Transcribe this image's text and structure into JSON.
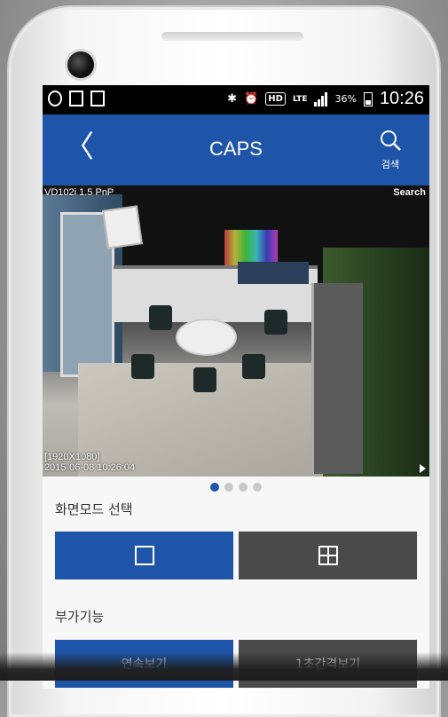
{
  "status_bar": {
    "left_icons": [
      "ring-icon",
      "image-icon",
      "chart-icon"
    ],
    "bluetooth": "✱",
    "alarm": "⏰",
    "hd_badge": "HD",
    "lte_label": "LTE",
    "battery_percent": "36%",
    "time": "10:26"
  },
  "app_bar": {
    "back_glyph": "〈",
    "title": "CAPS",
    "search_label": "검색",
    "accent_color": "#1f55a8"
  },
  "camera_view": {
    "overlay_top_left": "VD102i 1.5 PnP",
    "overlay_top_right": "Search",
    "overlay_resolution": "[1920X1080]",
    "overlay_timestamp": "2015-06-08 10:26:04"
  },
  "pager": {
    "total": 4,
    "active_index": 0
  },
  "screen_mode": {
    "label": "화면모드 선택",
    "options": [
      {
        "name": "single-view",
        "active": true
      },
      {
        "name": "quad-view",
        "active": false
      }
    ]
  },
  "extras": {
    "label": "부가기능",
    "buttons": [
      {
        "label": "연속보기",
        "active": true
      },
      {
        "label": "1초간격보기",
        "active": false
      }
    ]
  }
}
